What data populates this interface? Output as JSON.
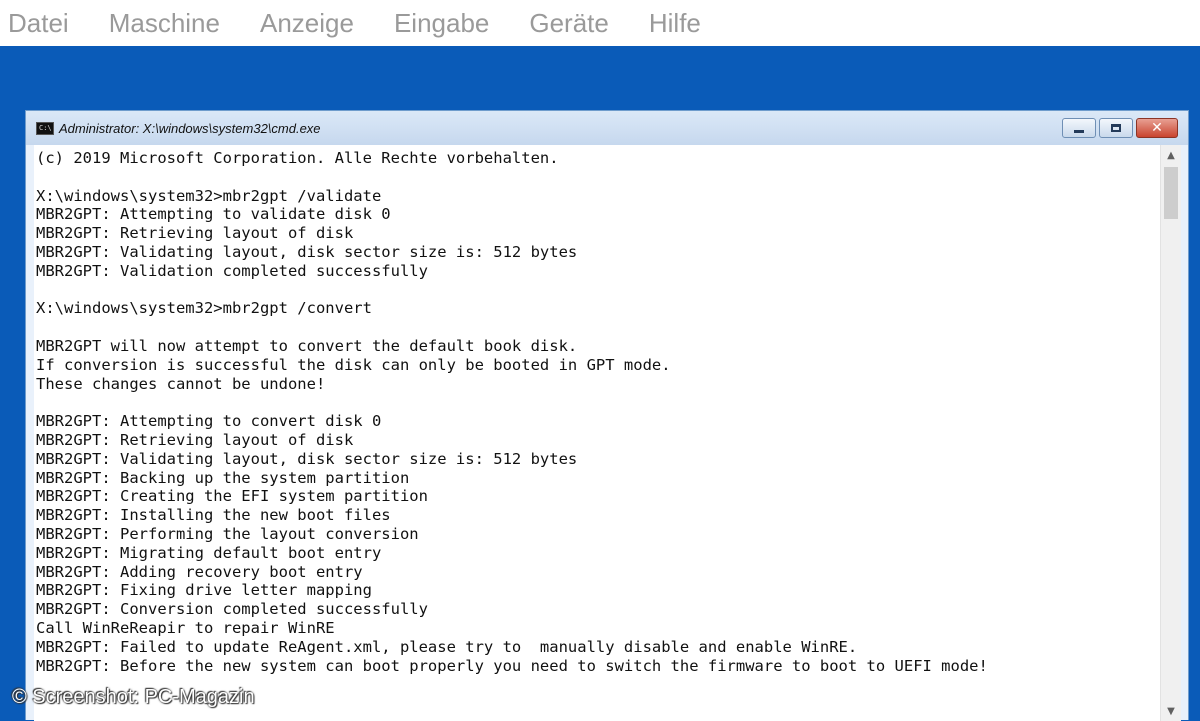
{
  "menubar": {
    "items": [
      "Datei",
      "Maschine",
      "Anzeige",
      "Eingabe",
      "Geräte",
      "Hilfe"
    ]
  },
  "window": {
    "title": "Administrator: X:\\windows\\system32\\cmd.exe",
    "icon": "cmd-icon",
    "icon_text": "C:\\",
    "controls": {
      "minimize": "minimize-icon",
      "maximize": "maximize-icon",
      "close_glyph": "✕"
    }
  },
  "console": {
    "lines": [
      "(c) 2019 Microsoft Corporation. Alle Rechte vorbehalten.",
      "",
      "X:\\windows\\system32>mbr2gpt /validate",
      "MBR2GPT: Attempting to validate disk 0",
      "MBR2GPT: Retrieving layout of disk",
      "MBR2GPT: Validating layout, disk sector size is: 512 bytes",
      "MBR2GPT: Validation completed successfully",
      "",
      "X:\\windows\\system32>mbr2gpt /convert",
      "",
      "MBR2GPT will now attempt to convert the default book disk.",
      "If conversion is successful the disk can only be booted in GPT mode.",
      "These changes cannot be undone!",
      "",
      "MBR2GPT: Attempting to convert disk 0",
      "MBR2GPT: Retrieving layout of disk",
      "MBR2GPT: Validating layout, disk sector size is: 512 bytes",
      "MBR2GPT: Backing up the system partition",
      "MBR2GPT: Creating the EFI system partition",
      "MBR2GPT: Installing the new boot files",
      "MBR2GPT: Performing the layout conversion",
      "MBR2GPT: Migrating default boot entry",
      "MBR2GPT: Adding recovery boot entry",
      "MBR2GPT: Fixing drive letter mapping",
      "MBR2GPT: Conversion completed successfully",
      "Call WinReReapir to repair WinRE",
      "MBR2GPT: Failed to update ReAgent.xml, please try to  manually disable and enable WinRE.",
      "MBR2GPT: Before the new system can boot properly you need to switch the firmware to boot to UEFI mode!"
    ]
  },
  "scrollbar": {
    "up": "▲",
    "down": "▼"
  },
  "watermark": "© Screenshot: PC-Magazin",
  "colors": {
    "desktop": "#0a5bb8",
    "menu_text": "#9a9a9a",
    "console_bg": "#ffffff",
    "console_text": "#111111"
  }
}
